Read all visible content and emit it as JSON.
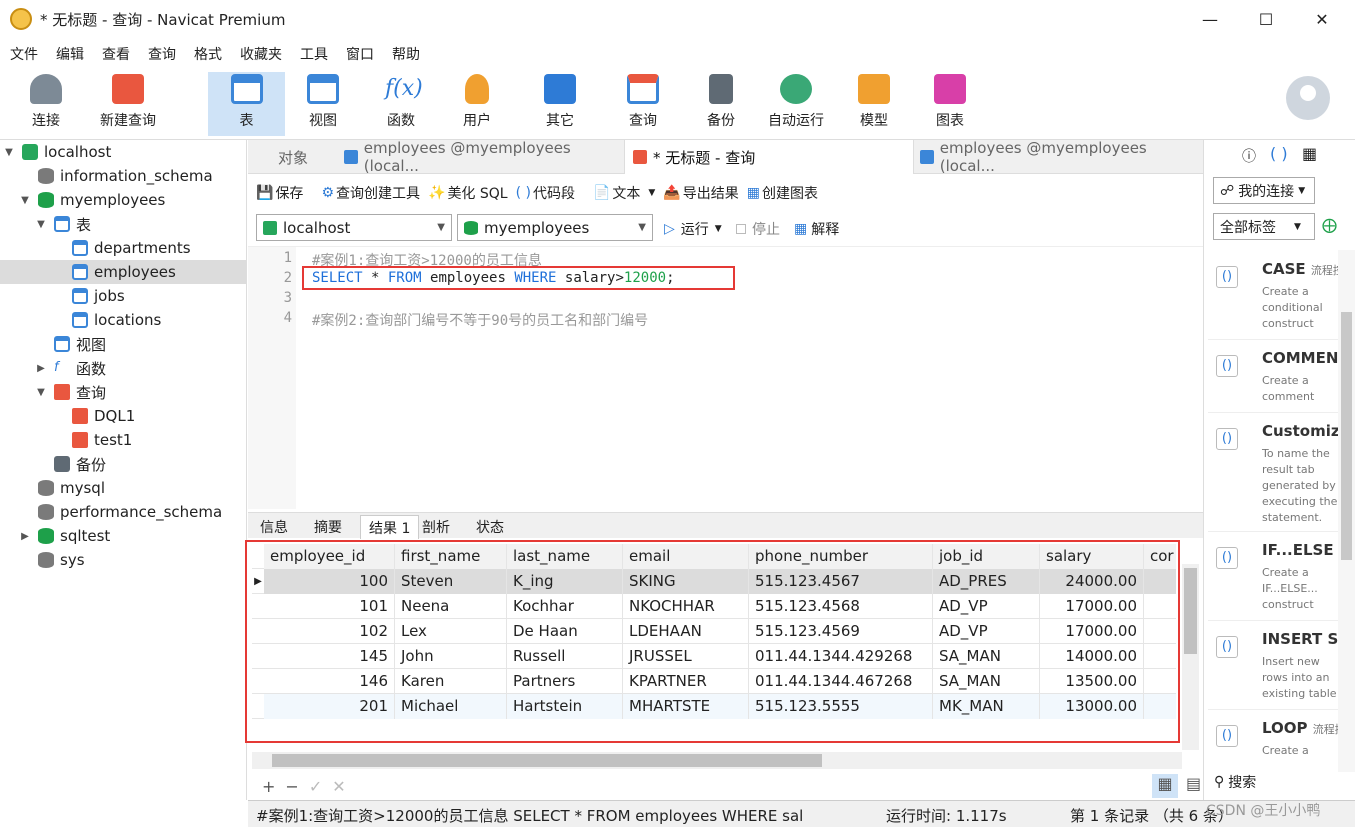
{
  "window": {
    "title": "* 无标题 - 查询 - Navicat Premium"
  },
  "menu": [
    "文件",
    "编辑",
    "查看",
    "查询",
    "格式",
    "收藏夹",
    "工具",
    "窗口",
    "帮助"
  ],
  "toolbar": {
    "connect": "连接",
    "new_query": "新建查询",
    "table": "表",
    "view": "视图",
    "function": "函数",
    "user": "用户",
    "other": "其它",
    "query": "查询",
    "backup": "备份",
    "automation": "自动运行",
    "model": "模型",
    "chart": "图表"
  },
  "tree": {
    "localhost": "localhost",
    "information_schema": "information_schema",
    "myemployees": "myemployees",
    "tables": "表",
    "departments": "departments",
    "employees": "employees",
    "jobs": "jobs",
    "locations": "locations",
    "views": "视图",
    "functions": "函数",
    "queries": "查询",
    "dql1": "DQL1",
    "test1": "test1",
    "backups": "备份",
    "mysql": "mysql",
    "performance_schema": "performance_schema",
    "sqltest": "sqltest",
    "sys": "sys"
  },
  "tabs": {
    "objects": "对象",
    "tab1": "employees @myemployees (local...",
    "tab2": "* 无标题 - 查询",
    "tab3": "employees @myemployees (local..."
  },
  "query_toolbar": {
    "save": "保存",
    "builder": "查询创建工具",
    "beautify": "美化 SQL",
    "snippet": "代码段",
    "text": "文本",
    "export": "导出结果",
    "create_chart": "创建图表"
  },
  "selectors": {
    "connection": "localhost",
    "database": "myemployees",
    "run": "运行",
    "stop": "停止",
    "explain": "解释"
  },
  "editor": {
    "lines": [
      "1",
      "2",
      "3",
      "4"
    ],
    "line1": "#案例1:查询工资>12000的员工信息",
    "l2_kw1": "SELECT",
    "l2_star": " * ",
    "l2_kw2": "FROM",
    "l2_tbl": " employees ",
    "l2_kw3": "WHERE",
    "l2_cond": " salary>",
    "l2_num": "12000",
    "l2_end": ";",
    "line4": "#案例2:查询部门编号不等于90号的员工名和部门编号"
  },
  "result_tabs": [
    "信息",
    "摘要",
    "结果 1",
    "剖析",
    "状态"
  ],
  "grid": {
    "headers": [
      "employee_id",
      "first_name",
      "last_name",
      "email",
      "phone_number",
      "job_id",
      "salary",
      "cor"
    ],
    "rows": [
      [
        "100",
        "Steven",
        "K_ing",
        "SKING",
        "515.123.4567",
        "AD_PRES",
        "24000.00"
      ],
      [
        "101",
        "Neena",
        "Kochhar",
        "NKOCHHAR",
        "515.123.4568",
        "AD_VP",
        "17000.00"
      ],
      [
        "102",
        "Lex",
        "De Haan",
        "LDEHAAN",
        "515.123.4569",
        "AD_VP",
        "17000.00"
      ],
      [
        "145",
        "John",
        "Russell",
        "JRUSSEL",
        "011.44.1344.429268",
        "SA_MAN",
        "14000.00"
      ],
      [
        "146",
        "Karen",
        "Partners",
        "KPARTNER",
        "011.44.1344.467268",
        "SA_MAN",
        "13500.00"
      ],
      [
        "201",
        "Michael",
        "Hartstein",
        "MHARTSTE",
        "515.123.5555",
        "MK_MAN",
        "13000.00"
      ]
    ]
  },
  "status": {
    "sql": "#案例1:查询工资>12000的员工信息 SELECT * FROM employees WHERE sal",
    "time": "运行时间: 1.117s",
    "records": "第 1 条记录 （共 6 条）"
  },
  "right_panel": {
    "connection_combo": "我的连接",
    "tags_combo": "全部标签",
    "search": "搜索",
    "snippets": [
      {
        "title": "CASE",
        "suffix": "流程控",
        "desc": "Create a conditional construct"
      },
      {
        "title": "COMMEN",
        "suffix": "",
        "desc": "Create a comment"
      },
      {
        "title": "Customiz",
        "suffix": "",
        "desc": "To name the result tab generated by executing the statement."
      },
      {
        "title": "IF...ELSE",
        "suffix": "",
        "desc": "Create a IF...ELSE... construct"
      },
      {
        "title": "INSERT Sy",
        "suffix": "",
        "desc": "Insert new rows into an existing table"
      },
      {
        "title": "LOOP",
        "suffix": "流程控",
        "desc": "Create a"
      }
    ]
  },
  "watermark": "CSDN @王小小鸭"
}
